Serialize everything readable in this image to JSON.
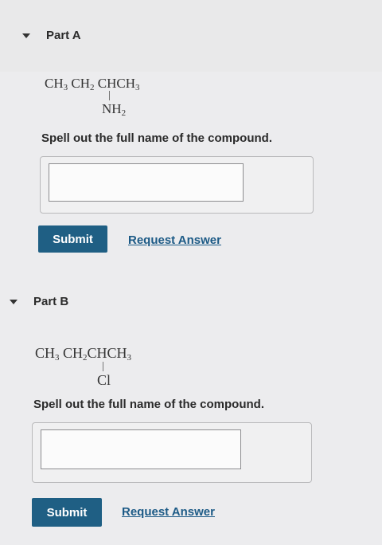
{
  "part_a": {
    "title": "Part A",
    "formula": {
      "main": [
        "CH",
        "3",
        " CH",
        "2",
        " CHCH",
        "3"
      ],
      "substituent": [
        "NH",
        "2"
      ]
    },
    "prompt": "Spell out the full name of the compound.",
    "answer_value": "",
    "submit_label": "Submit",
    "request_label": "Request Answer"
  },
  "part_b": {
    "title": "Part B",
    "formula": {
      "main": [
        "CH",
        "3",
        " CH",
        "2",
        "CHCH",
        "3"
      ],
      "substituent": [
        "Cl"
      ]
    },
    "prompt": "Spell out the full name of the compound.",
    "answer_value": "",
    "submit_label": "Submit",
    "request_label": "Request Answer"
  },
  "colors": {
    "submit_bg": "#1f5f84",
    "link": "#1c5a86",
    "page_bg": "#ececee"
  },
  "icons": {
    "collapse": "caret-down-icon"
  }
}
